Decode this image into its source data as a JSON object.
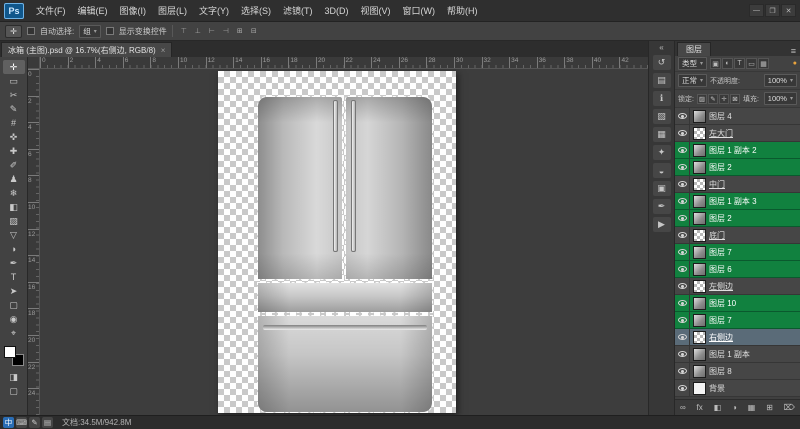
{
  "colors": {
    "label-green": "#11813f",
    "row-selected": "#5a6b78",
    "logo-blue": "#10578c",
    "ime-blue": "#2a6db5",
    "foreground": "#ffffff",
    "background": "#000000"
  },
  "icons": {
    "caret": "▾"
  },
  "titlebar": {
    "logo": "Ps",
    "menus": [
      "文件(F)",
      "编辑(E)",
      "图像(I)",
      "图层(L)",
      "文字(Y)",
      "选择(S)",
      "滤镜(T)",
      "3D(D)",
      "视图(V)",
      "窗口(W)",
      "帮助(H)"
    ],
    "window_controls": [
      {
        "name": "minimize-button",
        "glyph": "—"
      },
      {
        "name": "maximize-button",
        "glyph": "❐"
      },
      {
        "name": "close-button",
        "glyph": "✕"
      }
    ]
  },
  "options_bar": {
    "tool_icon": "✛",
    "auto_select_label": "自动选择:",
    "auto_select_value": "组",
    "show_transform_label": "显示变换控件",
    "align_icons": [
      "⊤",
      "⊥",
      "⊢",
      "⊣",
      "⊞",
      "⊟"
    ]
  },
  "document_tab": {
    "title": "冰箱 (主图).psd @ 16.7%(右侧边, RGB/8)",
    "close": "×"
  },
  "toolbar": {
    "tools": [
      {
        "name": "move-tool",
        "glyph": "✛",
        "active": true
      },
      {
        "name": "marquee-tool",
        "glyph": "▭"
      },
      {
        "name": "lasso-tool",
        "glyph": "✂"
      },
      {
        "name": "quick-selection-tool",
        "glyph": "✎"
      },
      {
        "name": "crop-tool",
        "glyph": "#"
      },
      {
        "name": "eyedropper-tool",
        "glyph": "✜"
      },
      {
        "name": "healing-brush-tool",
        "glyph": "✚"
      },
      {
        "name": "brush-tool",
        "glyph": "✐"
      },
      {
        "name": "clone-stamp-tool",
        "glyph": "♟"
      },
      {
        "name": "history-brush-tool",
        "glyph": "❄"
      },
      {
        "name": "eraser-tool",
        "glyph": "◧"
      },
      {
        "name": "gradient-tool",
        "glyph": "▨"
      },
      {
        "name": "blur-tool",
        "glyph": "▽"
      },
      {
        "name": "dodge-tool",
        "glyph": "◑"
      },
      {
        "name": "pen-tool",
        "glyph": "✒"
      },
      {
        "name": "type-tool",
        "glyph": "T"
      },
      {
        "name": "path-selection-tool",
        "glyph": "➤"
      },
      {
        "name": "shape-tool",
        "glyph": "▢"
      },
      {
        "name": "hand-tool",
        "glyph": "◉"
      },
      {
        "name": "zoom-tool",
        "glyph": "⌖"
      }
    ],
    "extras": [
      {
        "name": "quick-mask-button",
        "glyph": "◨"
      },
      {
        "name": "screen-mode-button",
        "glyph": "▢"
      }
    ]
  },
  "rulers": {
    "horizontal": [
      0,
      2,
      4,
      6,
      8,
      10,
      12,
      14,
      16,
      18,
      20,
      22,
      24,
      26,
      28,
      30,
      32,
      34,
      36,
      38,
      40,
      42
    ],
    "vertical": [
      0,
      2,
      4,
      6,
      8,
      10,
      12,
      14,
      16,
      18,
      20,
      22,
      24
    ]
  },
  "dock_strip": {
    "collapse": "«",
    "icons": [
      {
        "name": "history-panel-icon",
        "glyph": "↺"
      },
      {
        "name": "properties-panel-icon",
        "glyph": "▤"
      },
      {
        "name": "info-panel-icon",
        "glyph": "ℹ"
      },
      {
        "name": "color-panel-icon",
        "glyph": "▧"
      },
      {
        "name": "swatches-panel-icon",
        "glyph": "▦"
      },
      {
        "name": "styles-panel-icon",
        "glyph": "✦"
      },
      {
        "name": "adjustments-panel-icon",
        "glyph": "◒"
      },
      {
        "name": "channels-panel-icon",
        "glyph": "▣"
      },
      {
        "name": "paths-panel-icon",
        "glyph": "✒"
      },
      {
        "name": "actions-panel-icon",
        "glyph": "▶"
      }
    ]
  },
  "layers_panel": {
    "tab": "图层",
    "panel_menu_icon": "≡",
    "filter": {
      "kind_label": "类型",
      "icons": [
        "▣",
        "◐",
        "T",
        "▭",
        "▦"
      ],
      "switch": "●"
    },
    "blend": {
      "mode": "正常",
      "opacity_label": "不透明度:",
      "opacity_value": "100%"
    },
    "lock": {
      "label": "锁定:",
      "icons": [
        "▨",
        "✎",
        "✛",
        "⊠"
      ],
      "fill_label": "填充:",
      "fill_value": "100%"
    },
    "rows": [
      {
        "name": "图层 4",
        "thumb": "gray"
      },
      {
        "name": "左大门",
        "thumb": "checker",
        "underline": true
      },
      {
        "name": "图层 1 副本 2",
        "thumb": "gray",
        "color": "green"
      },
      {
        "name": "图层 2",
        "thumb": "gray",
        "color": "green"
      },
      {
        "name": "中门",
        "thumb": "checker",
        "underline": true
      },
      {
        "name": "图层 1 副本 3",
        "thumb": "gray",
        "color": "green"
      },
      {
        "name": "图层 2",
        "thumb": "gray",
        "color": "green"
      },
      {
        "name": "底门",
        "thumb": "checker",
        "underline": true
      },
      {
        "name": "图层 7",
        "thumb": "gray",
        "color": "green"
      },
      {
        "name": "图层 6",
        "thumb": "gray",
        "color": "green"
      },
      {
        "name": "左侧边",
        "thumb": "checker",
        "underline": true
      },
      {
        "name": "图层 10",
        "thumb": "gray",
        "color": "green"
      },
      {
        "name": "图层 7",
        "thumb": "gray",
        "color": "green"
      },
      {
        "name": "右侧边",
        "thumb": "checker",
        "underline": true,
        "selected": true
      },
      {
        "name": "图层 1 副本",
        "thumb": "gray"
      },
      {
        "name": "图层 8",
        "thumb": "gray"
      },
      {
        "name": "背景",
        "thumb": "white"
      }
    ],
    "bottom_icons": [
      {
        "name": "link-layers-icon",
        "glyph": "∞"
      },
      {
        "name": "layer-style-icon",
        "glyph": "fx"
      },
      {
        "name": "layer-mask-icon",
        "glyph": "◧"
      },
      {
        "name": "adjustment-layer-icon",
        "glyph": "◑"
      },
      {
        "name": "layer-group-icon",
        "glyph": "▦"
      },
      {
        "name": "new-layer-icon",
        "glyph": "⊞"
      },
      {
        "name": "delete-layer-icon",
        "glyph": "⌦"
      }
    ]
  },
  "status_bar": {
    "ime_icons": [
      {
        "name": "ime-chinese-icon",
        "glyph": "中",
        "chip": true
      },
      {
        "name": "keyboard-icon",
        "glyph": "⌨"
      },
      {
        "name": "ime-pen-icon",
        "glyph": "✎"
      },
      {
        "name": "ime-settings-icon",
        "glyph": "▤"
      }
    ],
    "doc_info": "文档:34.5M/942.8M"
  }
}
